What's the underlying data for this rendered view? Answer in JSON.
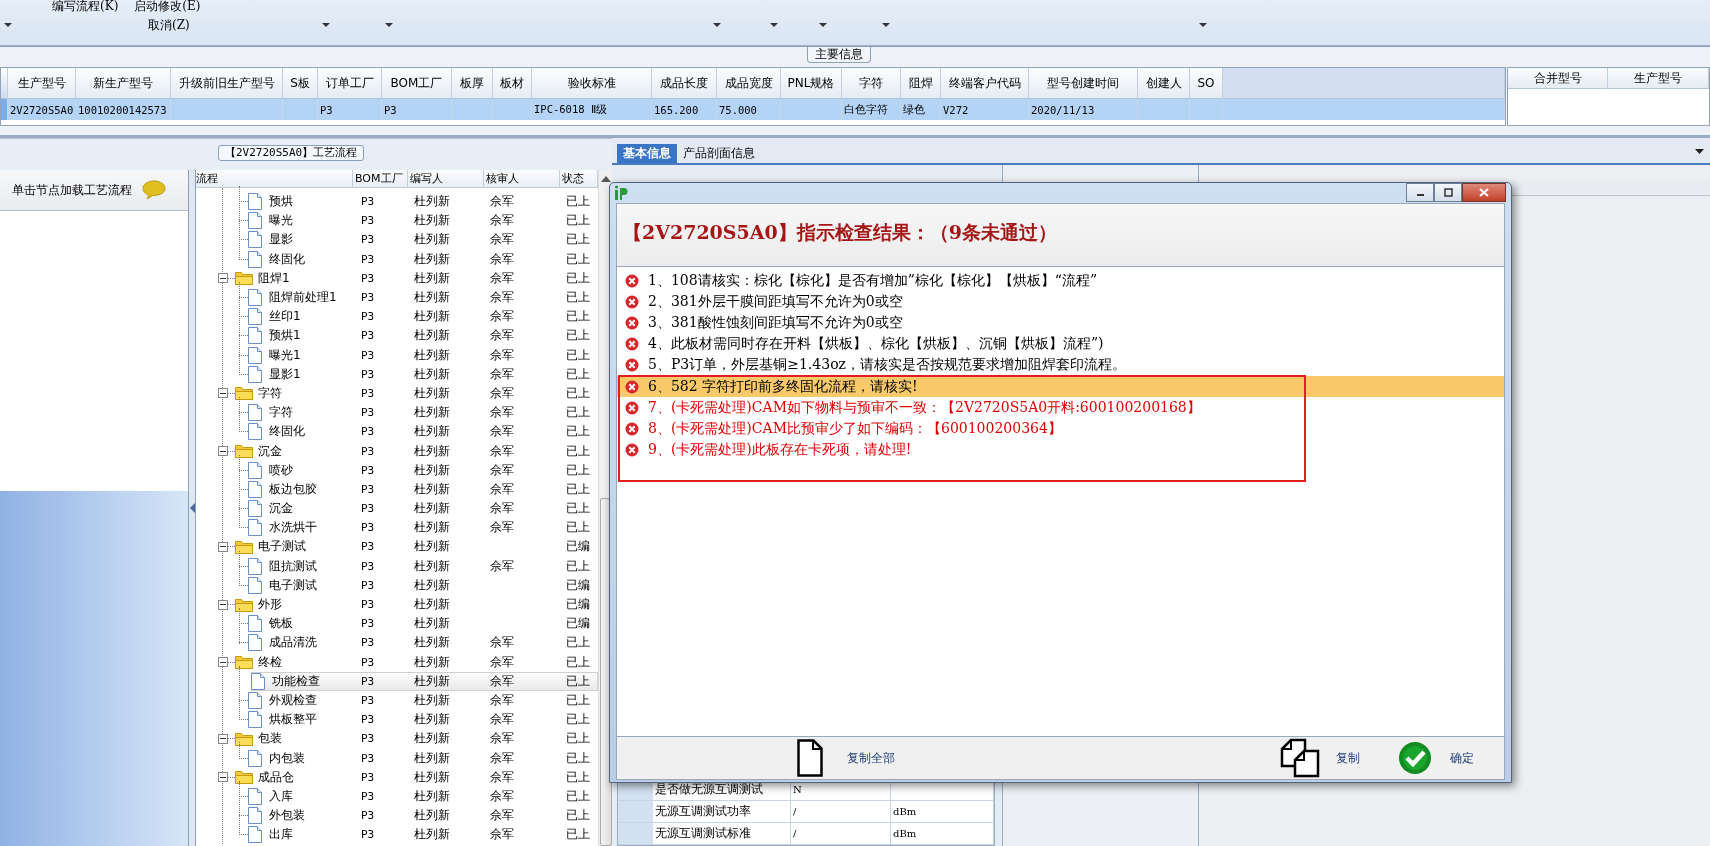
{
  "toolbar": {
    "menu_items": [
      "编写流程(K)",
      "启动修改(E)",
      "取消(Z)"
    ]
  },
  "main_info": {
    "title": "主要信息",
    "table": {
      "columns": [
        "生产型号",
        "新生产型号",
        "升级前旧生产型号",
        "S板",
        "订单工厂",
        "BOM工厂",
        "板厚",
        "板材",
        "验收标准",
        "成品长度",
        "成品宽度",
        "PNL规格",
        "字符",
        "阻焊",
        "终端客户代码",
        "型号创建时间",
        "创建人",
        "SO"
      ],
      "rows": [
        {
          "selected": true,
          "cells": [
            "2V2720S5A0",
            "10010200142573",
            null,
            null,
            "P3",
            "P3",
            null,
            null,
            "IPC-6018 Ⅱ级",
            "165.200",
            "75.000",
            null,
            "白色字符",
            "绿色",
            "V272",
            "2020/11/13",
            null,
            null
          ]
        }
      ]
    },
    "side_table": {
      "columns": [
        "合并型号",
        "生产型号"
      ]
    }
  },
  "process_flow": {
    "title": "【2V2720S5A0】工艺流程",
    "hint": "单击节点加载工艺流程",
    "columns": [
      "流程",
      "BOM工厂",
      "编写人",
      "核审人",
      "状态"
    ],
    "tree": [
      {
        "kind": "scrolled",
        "children": [
          {
            "kind": "step",
            "label": "预烘",
            "bom": "P3",
            "writer": "杜列新",
            "reviewer": "佘军",
            "status": "已上",
            "selected": false
          },
          {
            "kind": "step",
            "label": "曝光",
            "bom": "P3",
            "writer": "杜列新",
            "reviewer": "佘军",
            "status": "已上",
            "selected": false
          },
          {
            "kind": "step",
            "label": "显影",
            "bom": "P3",
            "writer": "杜列新",
            "reviewer": "佘军",
            "status": "已上",
            "selected": false
          },
          {
            "kind": "step",
            "label": "终固化",
            "bom": "P3",
            "writer": "杜列新",
            "reviewer": "佘军",
            "status": "已上",
            "selected": false
          }
        ]
      },
      {
        "kind": "folder",
        "label": "阻焊1",
        "bom": "P3",
        "writer": "杜列新",
        "reviewer": "佘军",
        "status": "已上",
        "selected": false,
        "expanded": true,
        "children": [
          {
            "kind": "step",
            "label": "阻焊前处理1",
            "bom": "P3",
            "writer": "杜列新",
            "reviewer": "佘军",
            "status": "已上",
            "selected": false
          },
          {
            "kind": "step",
            "label": "丝印1",
            "bom": "P3",
            "writer": "杜列新",
            "reviewer": "佘军",
            "status": "已上",
            "selected": false
          },
          {
            "kind": "step",
            "label": "预烘1",
            "bom": "P3",
            "writer": "杜列新",
            "reviewer": "佘军",
            "status": "已上",
            "selected": false
          },
          {
            "kind": "step",
            "label": "曝光1",
            "bom": "P3",
            "writer": "杜列新",
            "reviewer": "佘军",
            "status": "已上",
            "selected": false
          },
          {
            "kind": "step",
            "label": "显影1",
            "bom": "P3",
            "writer": "杜列新",
            "reviewer": "佘军",
            "status": "已上",
            "selected": false
          }
        ]
      },
      {
        "kind": "folder",
        "label": "字符",
        "bom": "P3",
        "writer": "杜列新",
        "reviewer": "佘军",
        "status": "已上",
        "selected": false,
        "expanded": true,
        "children": [
          {
            "kind": "step",
            "label": "字符",
            "bom": "P3",
            "writer": "杜列新",
            "reviewer": "佘军",
            "status": "已上",
            "selected": false
          },
          {
            "kind": "step",
            "label": "终固化",
            "bom": "P3",
            "writer": "杜列新",
            "reviewer": "佘军",
            "status": "已上",
            "selected": false
          }
        ]
      },
      {
        "kind": "folder",
        "label": "沉金",
        "bom": "P3",
        "writer": "杜列新",
        "reviewer": "佘军",
        "status": "已上",
        "selected": false,
        "expanded": true,
        "children": [
          {
            "kind": "step",
            "label": "喷砂",
            "bom": "P3",
            "writer": "杜列新",
            "reviewer": "佘军",
            "status": "已上",
            "selected": false
          },
          {
            "kind": "step",
            "label": "板边包胶",
            "bom": "P3",
            "writer": "杜列新",
            "reviewer": "佘军",
            "status": "已上",
            "selected": false
          },
          {
            "kind": "step",
            "label": "沉金",
            "bom": "P3",
            "writer": "杜列新",
            "reviewer": "佘军",
            "status": "已上",
            "selected": false
          },
          {
            "kind": "step",
            "label": "水洗烘干",
            "bom": "P3",
            "writer": "杜列新",
            "reviewer": "佘军",
            "status": "已上",
            "selected": false
          }
        ]
      },
      {
        "kind": "folder",
        "label": "电子测试",
        "bom": "P3",
        "writer": "杜列新",
        "status": "已编",
        "selected": false,
        "expanded": true,
        "children": [
          {
            "kind": "step",
            "label": "阻抗测试",
            "bom": "P3",
            "writer": "杜列新",
            "reviewer": "佘军",
            "status": "已上",
            "selected": false
          },
          {
            "kind": "step",
            "label": "电子测试",
            "bom": "P3",
            "writer": "杜列新",
            "status": "已编",
            "selected": false
          }
        ]
      },
      {
        "kind": "folder",
        "label": "外形",
        "bom": "P3",
        "writer": "杜列新",
        "status": "已编",
        "selected": false,
        "expanded": true,
        "children": [
          {
            "kind": "step",
            "label": "铣板",
            "bom": "P3",
            "writer": "杜列新",
            "status": "已编",
            "selected": false
          },
          {
            "kind": "step",
            "label": "成品清洗",
            "bom": "P3",
            "writer": "杜列新",
            "reviewer": "佘军",
            "status": "已上",
            "selected": false
          }
        ]
      },
      {
        "kind": "folder",
        "label": "终检",
        "bom": "P3",
        "writer": "杜列新",
        "reviewer": "佘军",
        "status": "已上",
        "selected": false,
        "expanded": true,
        "children": [
          {
            "kind": "step",
            "label": "功能检查",
            "bom": "P3",
            "writer": "杜列新",
            "reviewer": "佘军",
            "status": "已上",
            "selected": true
          },
          {
            "kind": "step",
            "label": "外观检查",
            "bom": "P3",
            "writer": "杜列新",
            "reviewer": "佘军",
            "status": "已上",
            "selected": false
          },
          {
            "kind": "step",
            "label": "烘板整平",
            "bom": "P3",
            "writer": "杜列新",
            "reviewer": "佘军",
            "status": "已上",
            "selected": false
          }
        ]
      },
      {
        "kind": "folder",
        "label": "包装",
        "bom": "P3",
        "writer": "杜列新",
        "reviewer": "佘军",
        "status": "已上",
        "selected": false,
        "expanded": true,
        "children": [
          {
            "kind": "step",
            "label": "内包装",
            "bom": "P3",
            "writer": "杜列新",
            "reviewer": "佘军",
            "status": "已上",
            "selected": false
          }
        ]
      },
      {
        "kind": "folder",
        "label": "成品仓",
        "bom": "P3",
        "writer": "杜列新",
        "reviewer": "佘军",
        "status": "已上",
        "selected": false,
        "expanded": true,
        "children": [
          {
            "kind": "step",
            "label": "入库",
            "bom": "P3",
            "writer": "杜列新",
            "reviewer": "佘军",
            "status": "已上",
            "selected": false
          },
          {
            "kind": "step",
            "label": "外包装",
            "bom": "P3",
            "writer": "杜列新",
            "reviewer": "佘军",
            "status": "已上",
            "selected": false
          },
          {
            "kind": "step",
            "label": "出库",
            "bom": "P3",
            "writer": "杜列新",
            "reviewer": "佘军",
            "status": "已上",
            "selected": false
          }
        ]
      }
    ]
  },
  "detail_tabs": [
    {
      "label": "基本信息",
      "selected": true
    },
    {
      "label": "产品剖面信息",
      "selected": false
    }
  ],
  "detail_table": {
    "rows": [
      {
        "label": "是否做无源互调测试",
        "value": "N"
      },
      {
        "label": "无源互调测试功率",
        "value": "/",
        "unit": "dBm"
      },
      {
        "label": "无源互调测试标准",
        "value": "/",
        "unit": "dBm"
      }
    ]
  },
  "dialog": {
    "heading": "【2V2720S5A0】指示检查结果：（9条未通过）",
    "items": [
      {
        "text": "1、108请核实：棕化【棕化】是否有增加”棕化【棕化】【烘板】“流程”",
        "color": "#000000",
        "selected": false
      },
      {
        "text": "2、381外层干膜间距填写不允许为0或空",
        "color": "#000000",
        "selected": false
      },
      {
        "text": "3、381酸性蚀刻间距填写不允许为0或空",
        "color": "#000000",
        "selected": false
      },
      {
        "text": "4、此板材需同时存在开料【烘板】、棕化【烘板】、沉铜【烘板】流程”)",
        "color": "#000000",
        "selected": false
      },
      {
        "text": "5、P3订单，外层基铜≥1.43oz，请核实是否按规范要求增加阻焊套印流程。",
        "color": "#000000",
        "selected": false
      },
      {
        "text": "6、582 字符打印前多终固化流程，请核实!",
        "color": "#000000",
        "selected": true
      },
      {
        "text": "7、(卡死需处理)CAM如下物料与预审不一致：【2V2720S5A0开料:600100200168】",
        "color": "#e00000",
        "selected": false
      },
      {
        "text": "8、(卡死需处理)CAM比预审少了如下编码：【600100200364】",
        "color": "#e00000",
        "selected": false
      },
      {
        "text": "9、(卡死需处理)此板存在卡死项，请处理!",
        "color": "#e00000",
        "selected": false
      }
    ],
    "buttons": [
      {
        "label": "复制全部",
        "kind": "copy_all"
      },
      {
        "label": "复制",
        "kind": "copy"
      },
      {
        "label": "确定",
        "kind": "ok"
      }
    ]
  }
}
